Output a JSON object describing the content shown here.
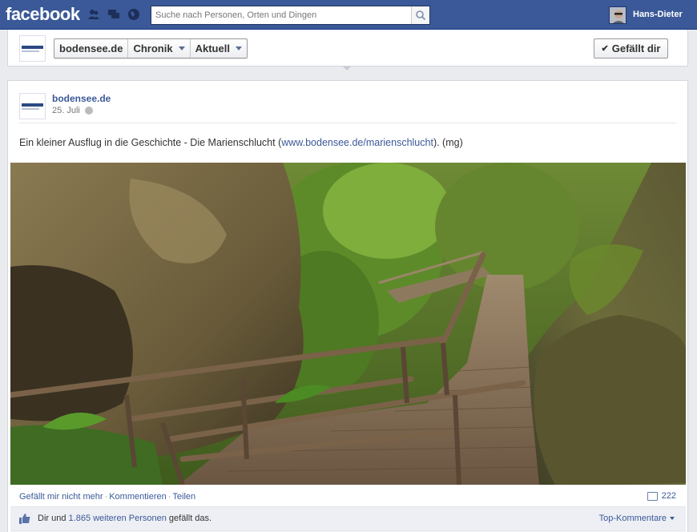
{
  "topbar": {
    "logo": "facebook",
    "search_placeholder": "Suche nach Personen, Orten und Dingen",
    "user_name": "Hans-Dieter"
  },
  "page_header": {
    "page_name": "bodensee.de",
    "nav_chronik": "Chronik",
    "nav_aktuell": "Aktuell",
    "like_button": "Gefällt dir"
  },
  "post": {
    "author": "bodensee.de",
    "date": "25. Juli",
    "text_before": "Ein kleiner Ausflug in die Geschichte - Die Marienschlucht (",
    "link": "www.bodensee.de/marienschlucht",
    "text_after": "). (mg)",
    "actions": {
      "unlike": "Gefällt mir nicht mehr",
      "comment": "Kommentieren",
      "share": "Teilen"
    },
    "comment_count": "222",
    "likes": {
      "prefix": "Dir und ",
      "others": "1.865 weiteren Personen",
      "suffix": " gefällt das."
    },
    "top_comments": "Top-Kommentare"
  },
  "colors": {
    "brand_blue": "#3b5998",
    "link": "#3b5998"
  }
}
